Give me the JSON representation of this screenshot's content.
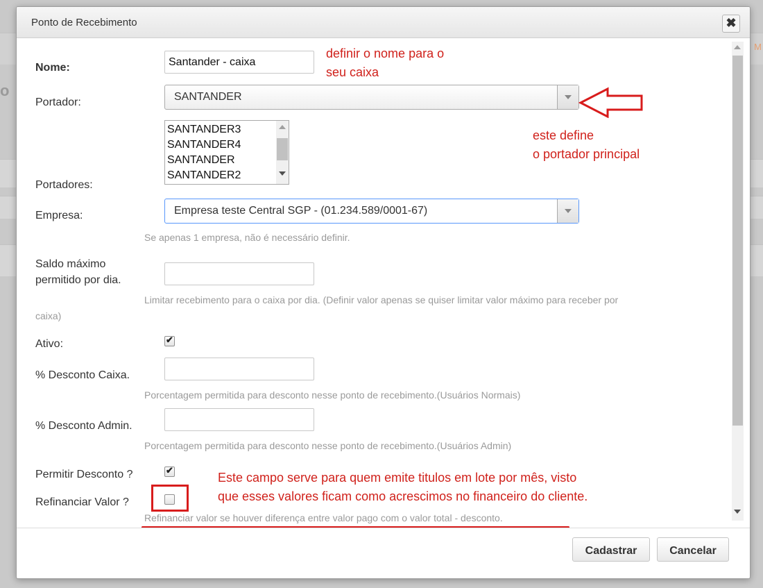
{
  "background": {
    "edge_text": "M"
  },
  "dialog": {
    "title": "Ponto de Recebimento",
    "close_glyph": "✖"
  },
  "form": {
    "nome": {
      "label": "Nome:",
      "value": "Santander - caixa"
    },
    "portador": {
      "label": "Portador:",
      "value": "SANTANDER"
    },
    "portadores": {
      "label": "Portadores:",
      "options": [
        "SANTANDER3",
        "SANTANDER4",
        "SANTANDER",
        "SANTANDER2"
      ]
    },
    "empresa": {
      "label": "Empresa:",
      "value": "Empresa teste Central SGP - (01.234.589/0001-67)",
      "help": "Se apenas 1 empresa, não é necessário definir."
    },
    "saldo": {
      "label_line1": "Saldo máximo",
      "label_line2": "permitido por dia.",
      "value": "",
      "help_line1": "Limitar recebimento para o caixa por dia. (Definir valor apenas se quiser limitar valor máximo para receber por",
      "help_line2": "caixa)"
    },
    "ativo": {
      "label": "Ativo:",
      "checked": true
    },
    "desconto_caixa": {
      "label": "% Desconto Caixa.",
      "value": "",
      "help": "Porcentagem permitida para desconto nesse ponto de recebimento.(Usuários Normais)"
    },
    "desconto_admin": {
      "label": "% Desconto Admin.",
      "value": "",
      "help": "Porcentagem permitida para desconto nesse ponto de recebimento.(Usuários Admin)"
    },
    "permitir_desconto": {
      "label": "Permitir Desconto ?",
      "checked": true
    },
    "refinanciar_valor": {
      "label": "Refinanciar Valor ?",
      "checked": false,
      "help": "Refinanciar valor se houver diferença entre valor pago com o valor total - desconto."
    }
  },
  "buttons": {
    "submit": "Cadastrar",
    "cancel": "Cancelar"
  },
  "annotations": {
    "nome_line1": "definir o nome para o",
    "nome_line2": "seu caixa",
    "portador_line1": "este define",
    "portador_line2": "o portador principal",
    "refinanciar_line1": "Este campo serve para quem emite titulos em lote por mês, visto",
    "refinanciar_line2": "que esses valores ficam como acrescimos no financeiro do cliente."
  },
  "colors": {
    "annotation": "#d0211b",
    "focus_border": "#5897fb"
  }
}
